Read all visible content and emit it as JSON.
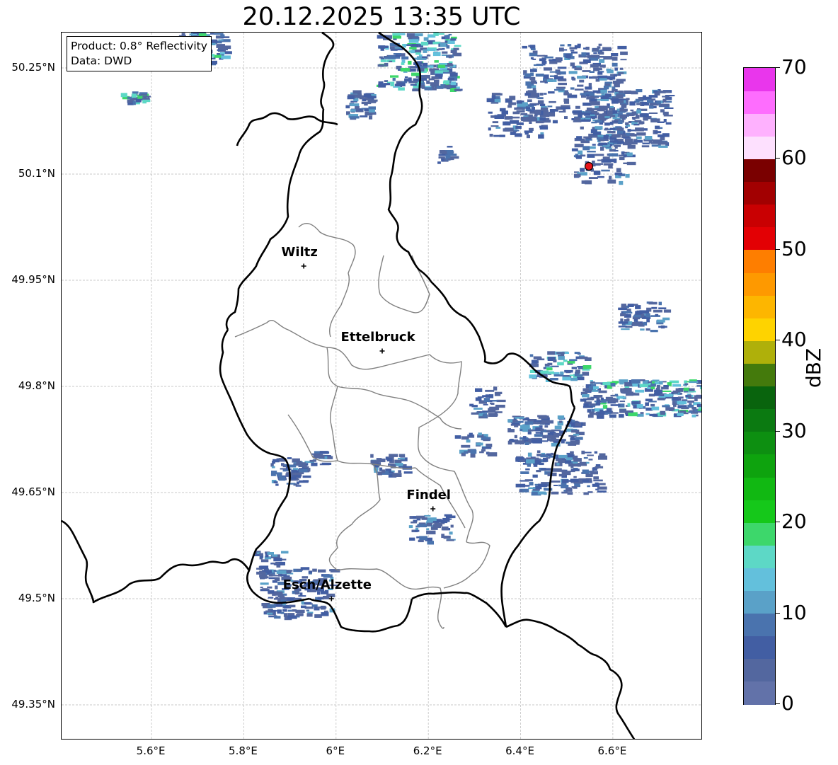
{
  "title": "20.12.2025 13:35 UTC",
  "info": {
    "product": "Product: 0.8° Reflectivity",
    "data_source": "Data: DWD"
  },
  "map": {
    "latitude_labels": [
      "50.25°N",
      "50.1°N",
      "49.95°N",
      "49.8°N",
      "49.65°N",
      "49.5°N",
      "49.35°N"
    ],
    "longitude_labels": [
      "5.6°E",
      "5.8°E",
      "6°E",
      "6.2°E",
      "6.4°E",
      "6.6°E"
    ],
    "extent": {
      "lon_min": 5.405,
      "lon_max": 6.795,
      "lat_min": 49.3,
      "lat_max": 50.3
    },
    "cities": [
      {
        "name": "Wiltz",
        "lon": 5.93,
        "lat": 49.97
      },
      {
        "name": "Ettelbruck",
        "lon": 6.1,
        "lat": 49.85
      },
      {
        "name": "Findel",
        "lon": 6.21,
        "lat": 49.627
      },
      {
        "name": "Esch/Alzette",
        "lon": 5.99,
        "lat": 49.5
      }
    ],
    "radar_site": {
      "lon": 6.548,
      "lat": 50.111,
      "color": "#e8151b"
    }
  },
  "colorbar": {
    "unit": "dBZ",
    "min": 0,
    "max": 70,
    "ticks": [
      "0",
      "10",
      "20",
      "30",
      "40",
      "50",
      "60",
      "70"
    ],
    "colors": [
      "#6272a9",
      "#53679f",
      "#425ea3",
      "#4a73ae",
      "#5aa1c8",
      "#63c0dc",
      "#5dd8c6",
      "#3dd76b",
      "#15c81a",
      "#11b812",
      "#0ea30e",
      "#0d8f11",
      "#0b7a11",
      "#09640d",
      "#447a0c",
      "#afb00a",
      "#fed300",
      "#fdb600",
      "#fe9900",
      "#fe7e00",
      "#e30004",
      "#c90002",
      "#a20001",
      "#7a0000",
      "#fde0fe",
      "#feb1fe",
      "#fe6dfe",
      "#e936ec"
    ]
  }
}
